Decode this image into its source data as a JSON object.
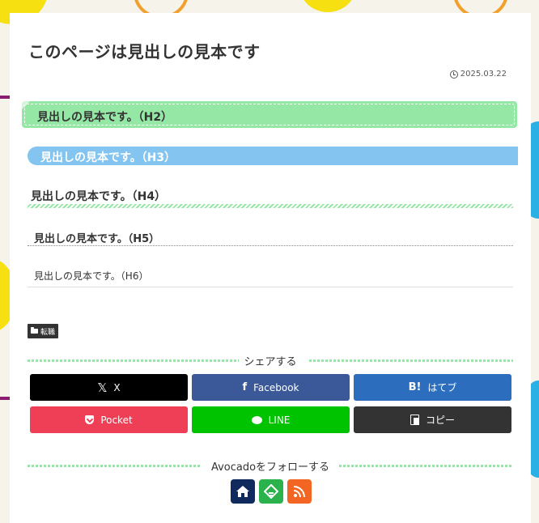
{
  "article": {
    "title": "このページは見出しの見本です",
    "date": "2025.03.22",
    "headings": {
      "h2": "見出しの見本です。（H2）",
      "h3": "見出しの見本です。（H3）",
      "h4": "見出しの見本です。（H4）",
      "h5": "見出しの見本です。（H5）",
      "h6": "見出しの見本です。（H6）"
    },
    "category": "転職"
  },
  "share": {
    "heading": "シェアする",
    "buttons": [
      {
        "label": "X",
        "icon": "x-icon",
        "color": "#000000"
      },
      {
        "label": "Facebook",
        "icon": "facebook-icon",
        "color": "#3b5998"
      },
      {
        "label": "はてブ",
        "icon": "hatena-bookmark-icon",
        "glyph": "B!",
        "color": "#2c6ebd"
      },
      {
        "label": "Pocket",
        "icon": "pocket-icon",
        "color": "#ef3f56"
      },
      {
        "label": "LINE",
        "icon": "line-icon",
        "color": "#00c300"
      },
      {
        "label": "コピー",
        "icon": "copy-icon",
        "color": "#333333"
      }
    ]
  },
  "follow": {
    "heading": "Avocadoをフォローする",
    "buttons": [
      {
        "icon": "home-icon",
        "color": "#102a5e"
      },
      {
        "icon": "feedly-icon",
        "color": "#2bb24c"
      },
      {
        "icon": "rss-icon",
        "color": "#f26522"
      }
    ]
  },
  "colors": {
    "accent_green": "#95e7a5",
    "accent_blue": "#83c4f0"
  }
}
